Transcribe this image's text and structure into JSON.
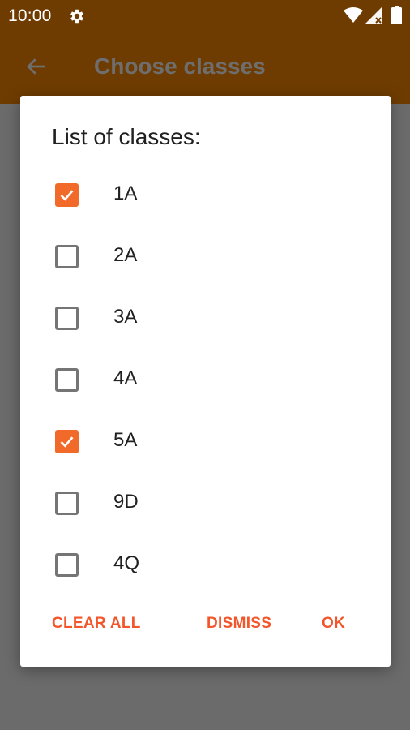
{
  "status_bar": {
    "time": "10:00",
    "icons": [
      "gear-icon",
      "wifi-icon",
      "cell-signal-icon",
      "battery-icon"
    ]
  },
  "app_bar": {
    "back_icon": "back-arrow-icon",
    "title": "Choose classes"
  },
  "dialog": {
    "title": "List of classes:",
    "options": [
      {
        "label": "1A",
        "checked": true
      },
      {
        "label": "2A",
        "checked": false
      },
      {
        "label": "3A",
        "checked": false
      },
      {
        "label": "4A",
        "checked": false
      },
      {
        "label": "5A",
        "checked": true
      },
      {
        "label": "9D",
        "checked": false
      },
      {
        "label": "4Q",
        "checked": false
      }
    ],
    "buttons": {
      "clear_all": "CLEAR ALL",
      "dismiss": "DISMISS",
      "ok": "OK"
    }
  },
  "colors": {
    "app_bar": "#6e3c00",
    "accent": "#f26a2a",
    "button_text": "#f2562a",
    "scrim": "#6b6b6b"
  }
}
